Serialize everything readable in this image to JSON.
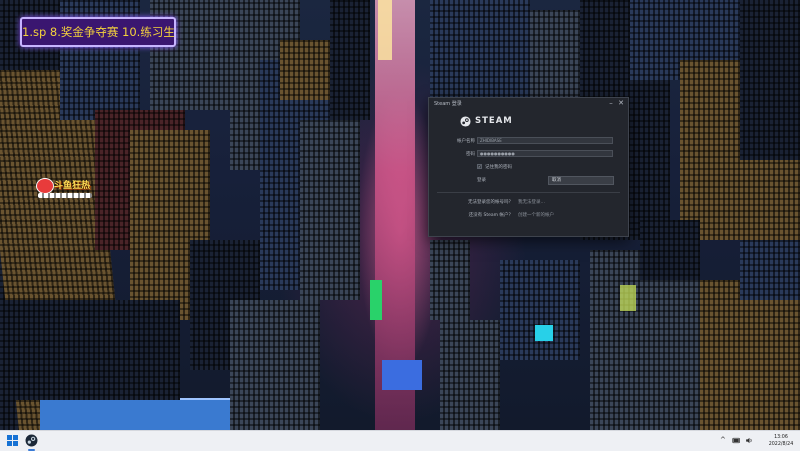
{
  "overlay": {
    "title": "1.sp 8.奖金争夺赛 10.练习生",
    "watermark_text": "斗鱼狂热"
  },
  "steam_dialog": {
    "window_title": "Steam 登录",
    "logo_text": "STEAM",
    "account_label": "帐户名称",
    "account_value": "ZHIDIBASE",
    "password_label": "密码",
    "password_value": "●●●●●●●●●●",
    "remember_label": "记住我的密码",
    "remember_checked": true,
    "cancel_label": "登录",
    "login_label": "取消",
    "help_question": "无法登录您的帐号吗？",
    "help_link": "我无法登录…",
    "create_question": "还没有 Steam 帐户？",
    "create_link": "创建一个新的帐户",
    "controls": {
      "minimize": "–",
      "close": "✕"
    }
  },
  "taskbar": {
    "start_icon": "windows-start-icon",
    "pinned": [
      {
        "name": "Steam",
        "icon": "steam-icon"
      }
    ],
    "tray": {
      "chevron": "^",
      "network": "wifi-icon",
      "volume": "speaker-icon"
    },
    "time": "13:06",
    "date": "2022/8/24"
  },
  "colors": {
    "overlay_bg": "#3a1670",
    "overlay_text": "#f4d23c",
    "steam_bg": "#23262d",
    "taskbar_bg": "#eef0f4",
    "start_blue": "#1672d4"
  }
}
